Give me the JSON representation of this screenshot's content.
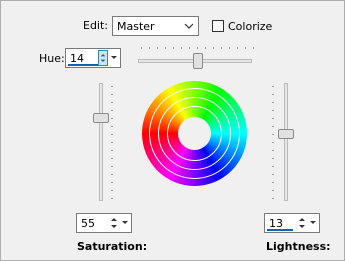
{
  "edit": {
    "label": "Edit:",
    "selected": "Master"
  },
  "colorize": {
    "label": "Colorize",
    "checked": false
  },
  "hue": {
    "label": "Hue:",
    "value": "14",
    "slider_level": 0.53
  },
  "saturation": {
    "label": "Saturation:",
    "value": "55",
    "slider_level": 0.72
  },
  "lightness": {
    "label": "Lightness:",
    "value": "13",
    "slider_level": 0.57
  },
  "icons": {
    "dropdown": "chevron-down-icon",
    "spin": "spin-arrows-icon",
    "spin_menu": "spin-menu-icon"
  },
  "colors": {
    "panel_bg": "#f0f0f0",
    "accent": "#0a64b4"
  }
}
